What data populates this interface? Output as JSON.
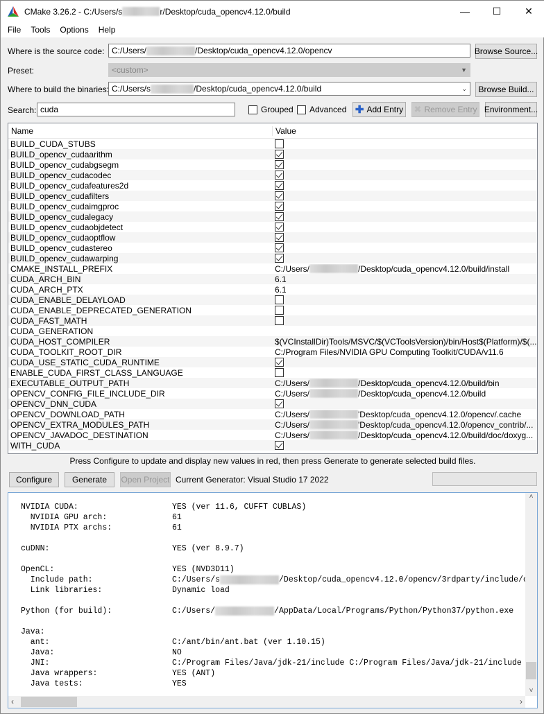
{
  "window": {
    "title_prefix": "CMake 3.26.2 - C:/Users/s",
    "title_suffix": "r/Desktop/cuda_opencv4.12.0/build",
    "minimize": "—",
    "maximize": "☐",
    "close": "✕"
  },
  "menu": [
    "File",
    "Tools",
    "Options",
    "Help"
  ],
  "source": {
    "label": "Where is the source code:",
    "prefix": "C:/Users/",
    "suffix": "/Desktop/cuda_opencv4.12.0/opencv",
    "button": "Browse Source..."
  },
  "preset": {
    "label": "Preset:",
    "value": "<custom>"
  },
  "build": {
    "label": "Where to build the binaries:",
    "prefix": "C:/Users/s",
    "suffix": "/Desktop/cuda_opencv4.12.0/build",
    "button": "Browse Build..."
  },
  "search": {
    "label": "Search:",
    "value": "cuda",
    "grouped": "Grouped",
    "advanced": "Advanced",
    "add_entry": "Add Entry",
    "remove_entry": "Remove Entry",
    "environment": "Environment..."
  },
  "table": {
    "headers": [
      "Name",
      "Value"
    ],
    "rows": [
      {
        "name": "BUILD_CUDA_STUBS",
        "type": "bool",
        "checked": false
      },
      {
        "name": "BUILD_opencv_cudaarithm",
        "type": "bool",
        "checked": true
      },
      {
        "name": "BUILD_opencv_cudabgsegm",
        "type": "bool",
        "checked": true
      },
      {
        "name": "BUILD_opencv_cudacodec",
        "type": "bool",
        "checked": true
      },
      {
        "name": "BUILD_opencv_cudafeatures2d",
        "type": "bool",
        "checked": true
      },
      {
        "name": "BUILD_opencv_cudafilters",
        "type": "bool",
        "checked": true
      },
      {
        "name": "BUILD_opencv_cudaimgproc",
        "type": "bool",
        "checked": true
      },
      {
        "name": "BUILD_opencv_cudalegacy",
        "type": "bool",
        "checked": true
      },
      {
        "name": "BUILD_opencv_cudaobjdetect",
        "type": "bool",
        "checked": true
      },
      {
        "name": "BUILD_opencv_cudaoptflow",
        "type": "bool",
        "checked": true
      },
      {
        "name": "BUILD_opencv_cudastereo",
        "type": "bool",
        "checked": true
      },
      {
        "name": "BUILD_opencv_cudawarping",
        "type": "bool",
        "checked": true
      },
      {
        "name": "CMAKE_INSTALL_PREFIX",
        "type": "path",
        "prefix": "C:/Users/",
        "suffix": "/Desktop/cuda_opencv4.12.0/build/install"
      },
      {
        "name": "CUDA_ARCH_BIN",
        "type": "text",
        "value": "6.1"
      },
      {
        "name": "CUDA_ARCH_PTX",
        "type": "text",
        "value": "6.1"
      },
      {
        "name": "CUDA_ENABLE_DELAYLOAD",
        "type": "bool",
        "checked": false
      },
      {
        "name": "CUDA_ENABLE_DEPRECATED_GENERATION",
        "type": "bool",
        "checked": false
      },
      {
        "name": "CUDA_FAST_MATH",
        "type": "bool",
        "checked": false
      },
      {
        "name": "CUDA_GENERATION",
        "type": "text",
        "value": ""
      },
      {
        "name": "CUDA_HOST_COMPILER",
        "type": "text",
        "value": "$(VCInstallDir)Tools/MSVC/$(VCToolsVersion)/bin/Host$(Platform)/$(..."
      },
      {
        "name": "CUDA_TOOLKIT_ROOT_DIR",
        "type": "text",
        "value": "C:/Program Files/NVIDIA GPU Computing Toolkit/CUDA/v11.6"
      },
      {
        "name": "CUDA_USE_STATIC_CUDA_RUNTIME",
        "type": "bool",
        "checked": true
      },
      {
        "name": "ENABLE_CUDA_FIRST_CLASS_LANGUAGE",
        "type": "bool",
        "checked": false
      },
      {
        "name": "EXECUTABLE_OUTPUT_PATH",
        "type": "path",
        "prefix": "C:/Users/",
        "suffix": "/Desktop/cuda_opencv4.12.0/build/bin"
      },
      {
        "name": "OPENCV_CONFIG_FILE_INCLUDE_DIR",
        "type": "path",
        "prefix": "C:/Users/",
        "suffix": "/Desktop/cuda_opencv4.12.0/build"
      },
      {
        "name": "OPENCV_DNN_CUDA",
        "type": "bool",
        "checked": true
      },
      {
        "name": "OPENCV_DOWNLOAD_PATH",
        "type": "path",
        "prefix": "C:/Users/",
        "suffix": "'Desktop/cuda_opencv4.12.0/opencv/.cache"
      },
      {
        "name": "OPENCV_EXTRA_MODULES_PATH",
        "type": "path",
        "prefix": "C:/Users/",
        "suffix": "'Desktop/cuda_opencv4.12.0/opencv_contrib/..."
      },
      {
        "name": "OPENCV_JAVADOC_DESTINATION",
        "type": "path",
        "prefix": "C:/Users/",
        "suffix": "/Desktop/cuda_opencv4.12.0/build/doc/doxyg..."
      },
      {
        "name": "WITH_CUDA",
        "type": "bool",
        "checked": true
      }
    ]
  },
  "message": "Press Configure to update and display new values in red, then press Generate to generate selected build files.",
  "actions": {
    "configure": "Configure",
    "generate": "Generate",
    "open_project": "Open Project",
    "generator": "Current Generator: Visual Studio 17 2022"
  },
  "output": [
    {
      "k": "NVIDIA CUDA:",
      "v": "YES (ver 11.6, CUFFT CUBLAS)"
    },
    {
      "k": "  NVIDIA GPU arch:",
      "v": "61"
    },
    {
      "k": "  NVIDIA PTX archs:",
      "v": "61"
    },
    {
      "k": "",
      "v": ""
    },
    {
      "k": "cuDNN:",
      "v": "YES (ver 8.9.7)"
    },
    {
      "k": "",
      "v": ""
    },
    {
      "k": "OpenCL:",
      "v": "YES (NVD3D11)"
    },
    {
      "k": "  Include path:",
      "v": "C:/Users/s",
      "v2": "/Desktop/cuda_opencv4.12.0/opencv/3rdparty/include/o"
    },
    {
      "k": "  Link libraries:",
      "v": "Dynamic load"
    },
    {
      "k": "",
      "v": ""
    },
    {
      "k": "Python (for build):",
      "v": "C:/Users/",
      "v2": "/AppData/Local/Programs/Python/Python37/python.exe"
    },
    {
      "k": "",
      "v": ""
    },
    {
      "k": "Java:",
      "v": ""
    },
    {
      "k": "  ant:",
      "v": "C:/ant/bin/ant.bat (ver 1.10.15)"
    },
    {
      "k": "  Java:",
      "v": "NO"
    },
    {
      "k": "  JNI:",
      "v": "C:/Program Files/Java/jdk-21/include C:/Program Files/Java/jdk-21/include"
    },
    {
      "k": "  Java wrappers:",
      "v": "YES (ANT)"
    },
    {
      "k": "  Java tests:",
      "v": "YES"
    }
  ],
  "colors": {
    "accent": "#0078d7",
    "add_icon": "#2a62c9"
  }
}
